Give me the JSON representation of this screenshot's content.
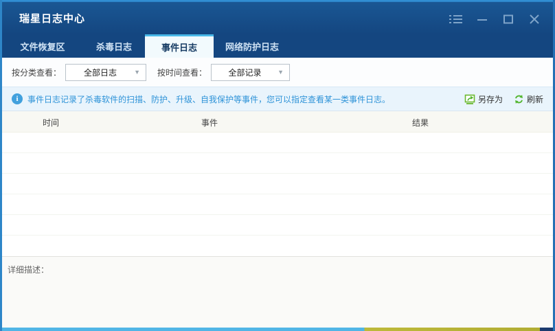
{
  "window": {
    "title": "瑞星日志中心"
  },
  "tabs": [
    {
      "label": "文件恢复区",
      "active": false
    },
    {
      "label": "杀毒日志",
      "active": false
    },
    {
      "label": "事件日志",
      "active": true
    },
    {
      "label": "网络防护日志",
      "active": false
    }
  ],
  "filters": {
    "category_label": "按分类查看：",
    "category_value": "全部日志",
    "time_label": "按时间查看：",
    "time_value": "全部记录"
  },
  "info_bar": {
    "message": "事件日志记录了杀毒软件的扫描、防护、升级、自我保护等事件，您可以指定查看某一类事件日志。",
    "save_as_label": "另存为",
    "refresh_label": "刷新"
  },
  "table": {
    "columns": [
      "时间",
      "事件",
      "结果"
    ],
    "rows": []
  },
  "detail": {
    "label": "详细描述："
  },
  "icons": {
    "info_glyph": "i",
    "chevron_down": "▼"
  },
  "colors": {
    "titlebar": "#164d88",
    "active_tab_accent": "#49b8e8",
    "info_text": "#2e93d8",
    "action_green": "#5cb52e",
    "border_blue": "#2e86c8"
  }
}
